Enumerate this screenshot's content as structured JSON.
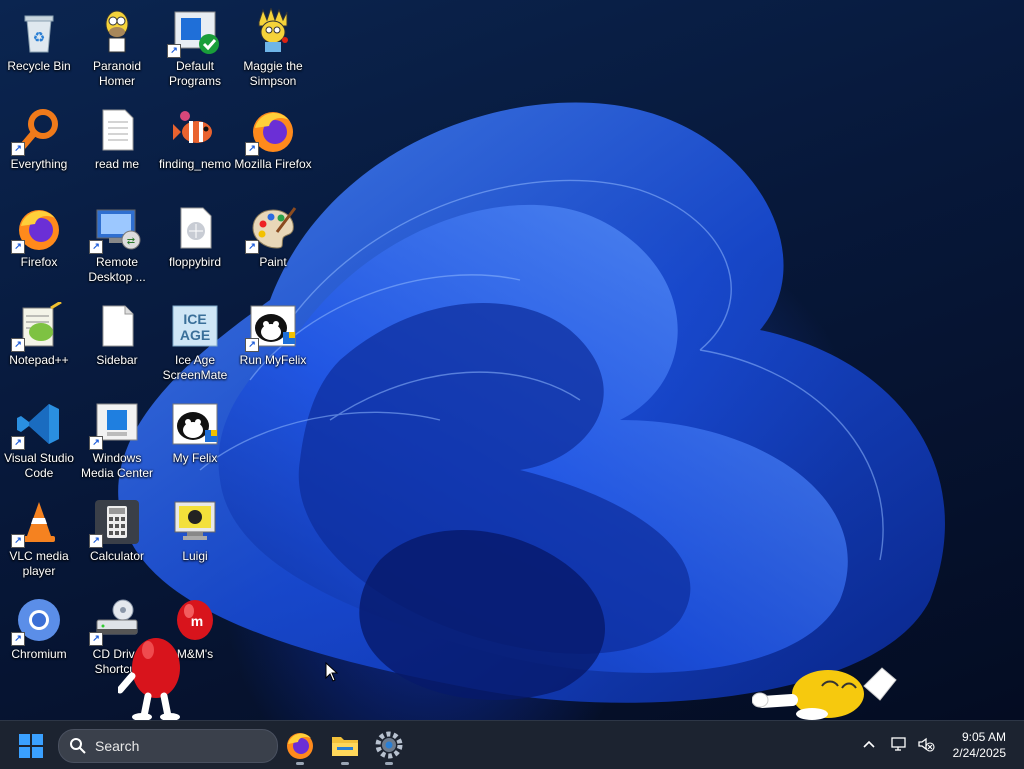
{
  "desktop": {
    "icons": [
      {
        "label": "Recycle Bin"
      },
      {
        "label": "Paranoid Homer"
      },
      {
        "label": "Default Programs"
      },
      {
        "label": "Maggie the Simpson"
      },
      {
        "label": "Everything"
      },
      {
        "label": "read me"
      },
      {
        "label": "finding_nemo"
      },
      {
        "label": "Mozilla Firefox"
      },
      {
        "label": "Firefox"
      },
      {
        "label": "Remote Desktop ..."
      },
      {
        "label": "floppybird"
      },
      {
        "label": "Paint"
      },
      {
        "label": "Notepad++"
      },
      {
        "label": "Sidebar"
      },
      {
        "label": "Ice Age ScreenMate"
      },
      {
        "label": "Run MyFelix"
      },
      {
        "label": "Visual Studio Code"
      },
      {
        "label": "Windows Media Center"
      },
      {
        "label": "My Felix"
      },
      {
        "label": "VLC media player"
      },
      {
        "label": "Calculator"
      },
      {
        "label": "Luigi"
      },
      {
        "label": "Chromium"
      },
      {
        "label": "CD Drive Shortcut"
      },
      {
        "label": "M&M's"
      }
    ]
  },
  "taskbar": {
    "search_label": "Search",
    "pinned": [
      "firefox-icon",
      "file-explorer-icon",
      "settings-icon"
    ],
    "clock": {
      "time": "9:05 AM",
      "date": "2/24/2025"
    }
  },
  "colors": {
    "taskbar_bg": "#1c2330",
    "accent": "#1a6cf0"
  }
}
